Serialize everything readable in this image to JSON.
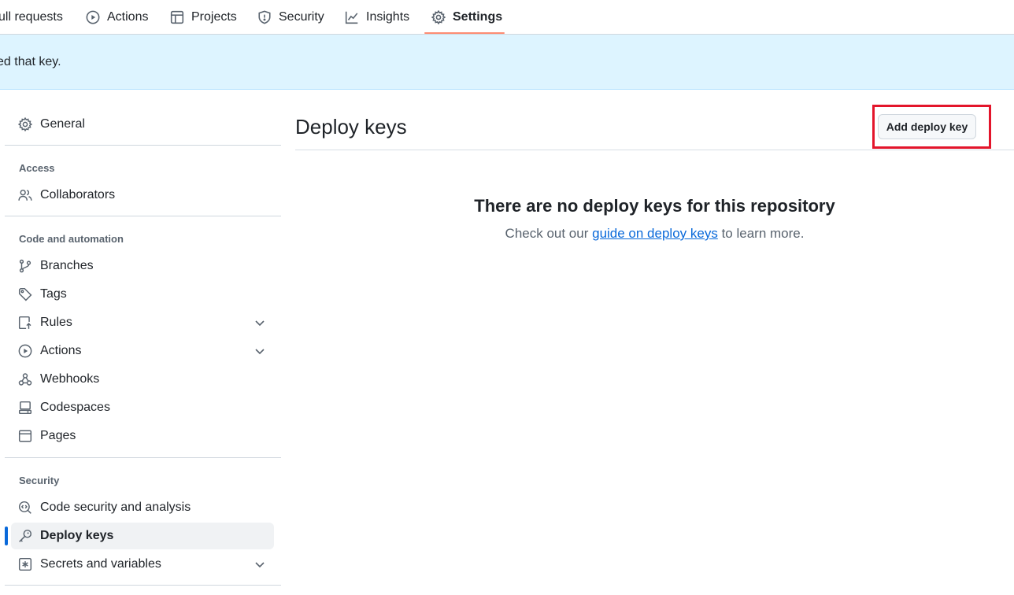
{
  "topnav": {
    "tabs": [
      {
        "label": "ull requests",
        "icon": "pull-request-icon"
      },
      {
        "label": "Actions",
        "icon": "play-icon"
      },
      {
        "label": "Projects",
        "icon": "table-icon"
      },
      {
        "label": "Security",
        "icon": "shield-icon"
      },
      {
        "label": "Insights",
        "icon": "graph-icon"
      },
      {
        "label": "Settings",
        "icon": "gear-icon",
        "selected": true
      }
    ],
    "underline_color": "#fd8c73"
  },
  "flash": {
    "text": "ed that key.",
    "background": "#ddf4ff"
  },
  "sidebar": {
    "general": {
      "label": "General",
      "icon": "gear-icon"
    },
    "groups": [
      {
        "heading": "Access",
        "items": [
          {
            "label": "Collaborators",
            "icon": "people-icon"
          }
        ]
      },
      {
        "heading": "Code and automation",
        "items": [
          {
            "label": "Branches",
            "icon": "branch-icon"
          },
          {
            "label": "Tags",
            "icon": "tag-icon"
          },
          {
            "label": "Rules",
            "icon": "rules-icon",
            "expandable": true
          },
          {
            "label": "Actions",
            "icon": "play-icon",
            "expandable": true
          },
          {
            "label": "Webhooks",
            "icon": "webhook-icon"
          },
          {
            "label": "Codespaces",
            "icon": "codespaces-icon"
          },
          {
            "label": "Pages",
            "icon": "browser-icon"
          }
        ]
      },
      {
        "heading": "Security",
        "items": [
          {
            "label": "Code security and analysis",
            "icon": "codescan-icon"
          },
          {
            "label": "Deploy keys",
            "icon": "key-icon",
            "active": true
          },
          {
            "label": "Secrets and variables",
            "icon": "asterisk-icon",
            "expandable": true
          }
        ]
      }
    ],
    "active_color": "#0969da"
  },
  "main": {
    "title": "Deploy keys",
    "add_button_label": "Add deploy key",
    "highlight_color": "#e3152b",
    "blankslate": {
      "title": "There are no deploy keys for this repository",
      "desc_before": "Check out our ",
      "link_text": "guide on deploy keys",
      "desc_after": " to learn more."
    }
  }
}
